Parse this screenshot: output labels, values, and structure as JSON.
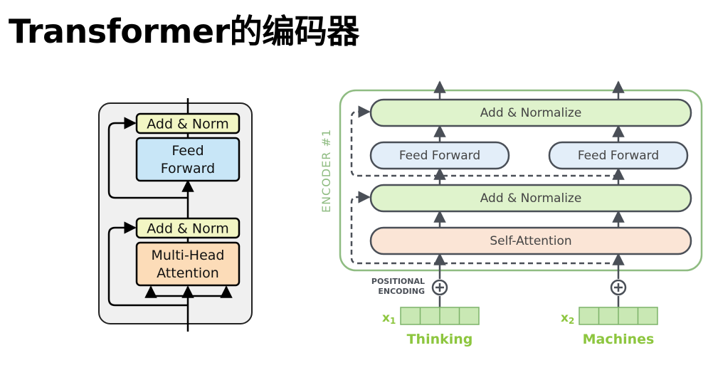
{
  "title": "Transformer的编码器",
  "left_diagram": {
    "add_norm_top": "Add & Norm",
    "feed_forward_line1": "Feed",
    "feed_forward_line2": "Forward",
    "add_norm_bottom": "Add & Norm",
    "attention_line1": "Multi-Head",
    "attention_line2": "Attention"
  },
  "right_diagram": {
    "encoder_label": "ENCODER #1",
    "add_normalize_top": "Add & Normalize",
    "feed_forward_1": "Feed Forward",
    "feed_forward_2": "Feed Forward",
    "add_normalize_bottom": "Add & Normalize",
    "self_attention": "Self-Attention",
    "positional_line1": "POSITIONAL",
    "positional_line2": "ENCODING",
    "x1_label": "x",
    "x1_sub": "1",
    "x2_label": "x",
    "x2_sub": "2",
    "word1": "Thinking",
    "word2": "Machines"
  },
  "colors": {
    "add_norm_fill": "#f2f6c4",
    "feed_forward_fill": "#c8e6f7",
    "attention_fill": "#fcdcb8",
    "encoder_border": "#8fbc82",
    "add_normalize_fill": "#dff3cc",
    "feed_forward_right_fill": "#e3eef9",
    "self_attention_fill": "#fbe5d6",
    "word_green": "#8dc63f"
  }
}
